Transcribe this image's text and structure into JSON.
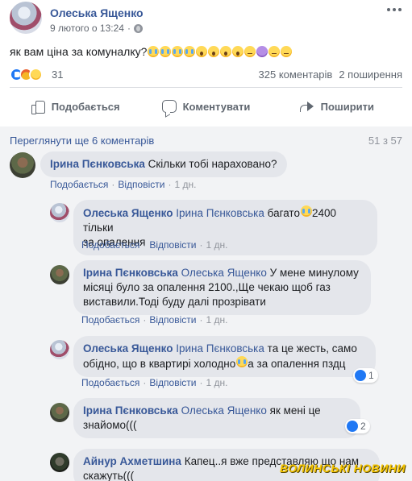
{
  "post": {
    "author": "Олеська Ященко",
    "date": "9 лютого о 13:24",
    "text": "як вам ціна за комуналку?",
    "emojis": [
      "crying-face",
      "crying-face",
      "crying-face",
      "crying-face",
      "astonished-face",
      "astonished-face",
      "astonished-face",
      "astonished-face",
      "disappointed-face",
      "purple-face",
      "neutral-face",
      "neutral-face"
    ]
  },
  "reactions": {
    "icons": [
      "like",
      "angry",
      "sad"
    ],
    "count": "31",
    "comments": "325 коментарів",
    "shares": "2 поширення"
  },
  "actions": {
    "like": "Подобається",
    "comment": "Коментувати",
    "share": "Поширити"
  },
  "comments_area": {
    "view_more": "Переглянути ще 6 коментарів",
    "count": "51 з 57"
  },
  "comments": [
    {
      "author": "Ірина Пєнковська",
      "text": "Скільки тобі нараховано?",
      "like": "Подобається",
      "reply": "Відповісти",
      "time": "1 дн."
    },
    {
      "author": "Олеська Ященко",
      "tag": "Ірина Пєнковська",
      "text_a": "багато",
      "text_b": "2400 тільки",
      "text_c": "за опалення",
      "like": "Подобається",
      "reply": "Відповісти",
      "time": "1 дн."
    },
    {
      "author": "Ірина Пєнковська",
      "tag": "Олеська Ященко",
      "line1": "У мене минулому",
      "line2": "місяці було за опалення 2100.,Ще чекаю щоб газ",
      "line3": "виставили.Тоді буду далі прозрівати",
      "like": "Подобається",
      "reply": "Відповісти",
      "time": "1 дн."
    },
    {
      "author": "Олеська Ященко",
      "tag": "Ірина Пєнковська",
      "line1": "та це жесть, само",
      "line2a": "обідно, що в квартирі холодно",
      "line2b": "а за опалення пздц",
      "like": "Подобається",
      "reply": "Відповісти",
      "time": "1 дн.",
      "reactions": "1"
    },
    {
      "author": "Ірина Пєнковська",
      "tag": "Олеська Ященко",
      "text": "як мені це знайомо(((",
      "reactions": "2"
    },
    {
      "author": "Айнур Ахметшина",
      "line1": "Капец..я вже представляю що нам",
      "line2": "скажуть((("
    }
  ],
  "watermark": "ВОЛИНСЬКІ НОВИНИ"
}
